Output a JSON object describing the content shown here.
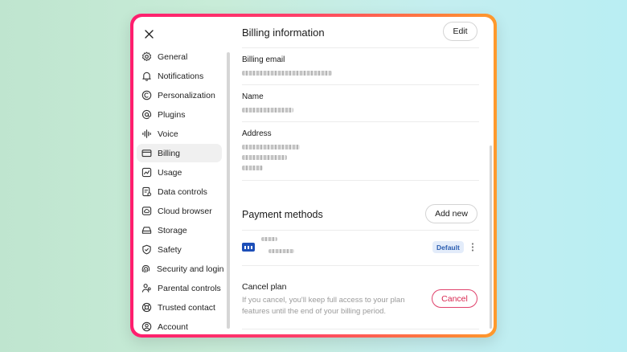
{
  "dialog": {
    "close_icon": "close-icon"
  },
  "sidebar": {
    "items": [
      {
        "label": "General",
        "icon": "gear-icon",
        "active": false
      },
      {
        "label": "Notifications",
        "icon": "bell-icon",
        "active": false
      },
      {
        "label": "Personalization",
        "icon": "personalization-icon",
        "active": false
      },
      {
        "label": "Plugins",
        "icon": "at-sign-icon",
        "active": false
      },
      {
        "label": "Voice",
        "icon": "waveform-icon",
        "active": false
      },
      {
        "label": "Billing",
        "icon": "card-icon",
        "active": true
      },
      {
        "label": "Usage",
        "icon": "chart-icon",
        "active": false
      },
      {
        "label": "Data controls",
        "icon": "database-icon",
        "active": false
      },
      {
        "label": "Cloud browser",
        "icon": "cloud-icon",
        "active": false
      },
      {
        "label": "Storage",
        "icon": "storage-icon",
        "active": false
      },
      {
        "label": "Safety",
        "icon": "shield-icon",
        "active": false
      },
      {
        "label": "Security and login",
        "icon": "fingerprint-icon",
        "active": false
      },
      {
        "label": "Parental controls",
        "icon": "people-icon",
        "active": false
      },
      {
        "label": "Trusted contact",
        "icon": "lifebuoy-icon",
        "active": false
      },
      {
        "label": "Account",
        "icon": "account-icon",
        "active": false
      }
    ]
  },
  "billing": {
    "title": "Billing information",
    "edit_label": "Edit",
    "email_label": "Billing email",
    "name_label": "Name",
    "address_label": "Address"
  },
  "payment": {
    "title": "Payment methods",
    "add_label": "Add new",
    "default_badge": "Default",
    "more_icon": "kebab-icon"
  },
  "cancel": {
    "title": "Cancel plan",
    "description": "If you cancel, you'll keep full access to your plan features until the end of your billing period.",
    "button_label": "Cancel"
  },
  "colors": {
    "frame_start": "#ff1e6e",
    "frame_end": "#ff9a2c",
    "cancel": "#d8264f",
    "badge_bg": "#e3ecfa",
    "badge_text": "#2a5db0",
    "card_logo": "#1d4fb8"
  }
}
